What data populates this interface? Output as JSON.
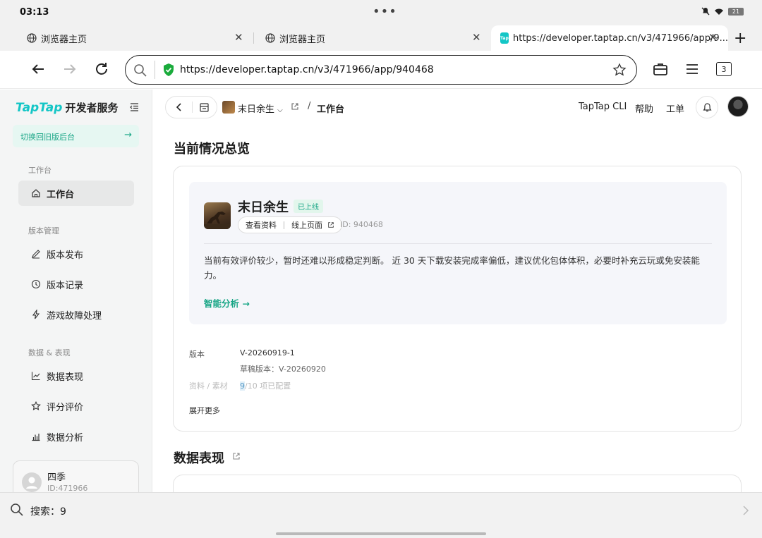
{
  "status": {
    "time": "03:13",
    "battery": "21"
  },
  "tabs": [
    {
      "label": "浏览器主页"
    },
    {
      "label": "浏览器主页"
    },
    {
      "label": "https://developer.taptap.cn/v3/471966/app/9...",
      "favicon": "Tap"
    }
  ],
  "address": {
    "url": "https://developer.taptap.cn/v3/471966/app/940468",
    "tab_count": "3"
  },
  "sidebar": {
    "logo_brand": "TapTap",
    "logo_suffix": "开发者服务",
    "switch_label": "切换回旧版后台",
    "groups": [
      {
        "title": "工作台",
        "items": [
          {
            "label": "工作台",
            "icon": "home-icon"
          }
        ]
      },
      {
        "title": "版本管理",
        "items": [
          {
            "label": "版本发布",
            "icon": "pen-icon"
          },
          {
            "label": "版本记录",
            "icon": "clock-icon"
          },
          {
            "label": "游戏故障处理",
            "icon": "bolt-icon"
          }
        ]
      },
      {
        "title": "数据 & 表现",
        "items": [
          {
            "label": "数据表现",
            "icon": "trend-icon"
          },
          {
            "label": "评分评价",
            "icon": "star-icon"
          },
          {
            "label": "数据分析",
            "icon": "bar-chart-icon"
          }
        ]
      }
    ],
    "user": {
      "name": "四季",
      "id": "ID:471966"
    }
  },
  "header": {
    "game": "末日余生",
    "current": "工作台",
    "separator": "/",
    "links": [
      "TapTap CLI",
      "帮助",
      "工单"
    ]
  },
  "overview": {
    "title": "当前情况总览",
    "game_name": "末日余生",
    "status_badge": "已上线",
    "link_profile": "查看资料",
    "link_online": "线上页面",
    "game_id": "ID: 940468",
    "analysis": "当前有效评价较少，暂时还难以形成稳定判断。 近 30 天下载安装完成率偏低，建议优化包体体积，必要时补充云玩或免安装能力。",
    "ai_link": "智能分析 →",
    "version_label": "版本",
    "version_value": "V-20260919-1",
    "draft_value": "草稿版本：V-20260920",
    "material_label": "资料 / 素材",
    "material_highlight": "9",
    "material_value": "/10 项已配置",
    "expand": "展开更多"
  },
  "data_section": {
    "title": "数据表现"
  },
  "find": {
    "query": "搜索：9"
  },
  "colors": {
    "accent": "#14c6c6",
    "green": "#17a585"
  }
}
